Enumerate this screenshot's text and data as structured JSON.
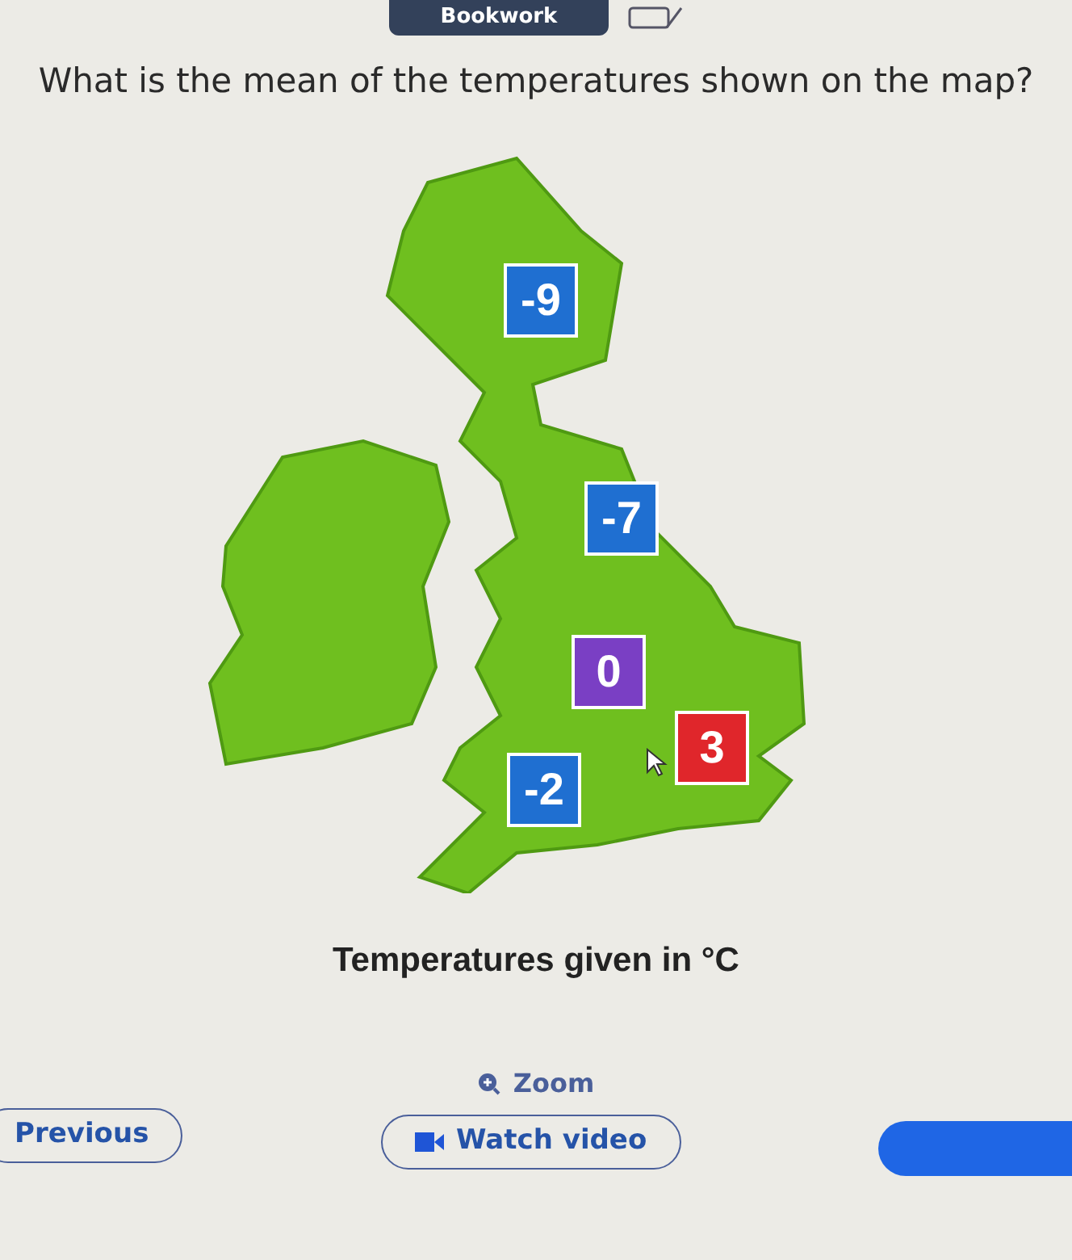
{
  "header": {
    "bookwork": "Bookwork"
  },
  "question": "What is the mean of the temperatures shown on the map?",
  "map": {
    "labels": [
      {
        "value": "-9",
        "color": "#1f6fd1"
      },
      {
        "value": "-7",
        "color": "#1f6fd1"
      },
      {
        "value": "0",
        "color": "#7a3fc4"
      },
      {
        "value": "3",
        "color": "#e0262b"
      },
      {
        "value": "-2",
        "color": "#1f6fd1"
      }
    ]
  },
  "caption": "Temperatures given in °C",
  "zoom": "Zoom",
  "buttons": {
    "previous": "Previous",
    "watch": "Watch video"
  }
}
